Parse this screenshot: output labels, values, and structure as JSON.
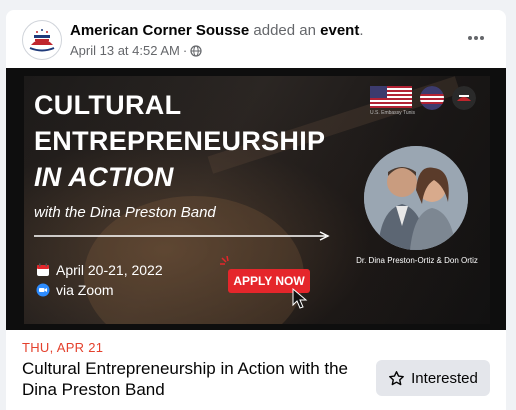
{
  "post": {
    "author": "American Corner Sousse",
    "action": "added an",
    "object": "event",
    "period": ".",
    "timestamp": "April 13 at 4:52 AM",
    "separator": "·",
    "privacy_icon": "globe-icon",
    "more_icon": "more-horizontal-icon"
  },
  "banner": {
    "title_line_1": "CULTURAL",
    "title_line_2": "ENTREPRENEURSHIP",
    "title_line_3": "IN ACTION",
    "subtitle": "with the Dina Preston Band",
    "date_text": "April 20-21, 2022",
    "platform_text": "via Zoom",
    "apply_label": "APPLY NOW",
    "flag_caption": "U.S. Embassy Tunis",
    "photo_caption": "Dr. Dina Preston-Ortiz & Don Ortiz"
  },
  "event": {
    "date": "THU, APR 21",
    "title": "Cultural Entrepreneurship in Action with the Dina Preston Band",
    "interested_label": "Interested"
  },
  "colors": {
    "accent_red": "#e5262b",
    "date_red": "#e4412d",
    "page_bg": "#f0f2f5",
    "button_bg": "#e4e6eb"
  }
}
